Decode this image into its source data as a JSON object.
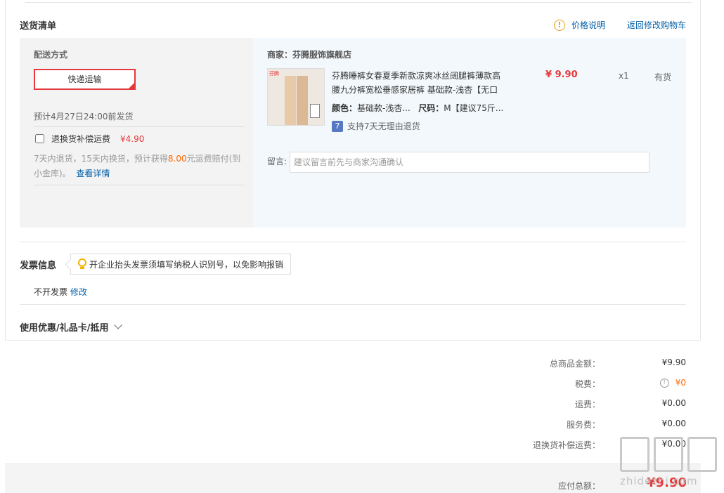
{
  "delivery": {
    "title": "送货清单",
    "price_note": "价格说明",
    "back_to_cart": "返回修改购物车",
    "shipping_method_label": "配送方式",
    "express_option": "快递运输",
    "ship_date": "预计4月27日24:00前发货",
    "return_insurance_label": "退换货补偿运费",
    "return_insurance_price": "¥4.90",
    "return_desc_prefix": "7天内退货，15天内换货，预计获得",
    "return_desc_amount": "8.00",
    "return_desc_suffix": "元运费赔付(到小金库)。",
    "view_details": "查看详情"
  },
  "goods": {
    "merchant": "商家：芬腾服饰旗舰店",
    "thumb_brand": "芬腾",
    "name": "芬腾睡裤女春夏季新款凉爽冰丝阔腿裤薄款高腰九分裤宽松垂感家居裤 基础款-浅杏【无口",
    "color_label": "颜色：",
    "color_value": "基础款-浅杏...",
    "size_label": "尺码：",
    "size_value": "M【建议75斤...",
    "support_badge": "7",
    "support_text": "支持7天无理由退货",
    "price": "¥ 9.90",
    "qty": "x1",
    "stock": "有货",
    "message_label": "留言:",
    "message_placeholder": "建议留言前先与商家沟通确认"
  },
  "invoice": {
    "title": "发票信息",
    "tip": "开企业抬头发票须填写纳税人识别号，以免影响报销",
    "status": "不开发票",
    "edit": "修改"
  },
  "coupon": {
    "title": "使用优惠/礼品卡/抵用"
  },
  "summary": {
    "goods_total_label": "总商品金额：",
    "goods_total": "¥9.90",
    "tax_label": "税费：",
    "tax": "¥0",
    "shipping_label": "运费：",
    "shipping": "¥0.00",
    "service_label": "服务费：",
    "service": "¥0.00",
    "return_fee_label": "退换货补偿运费：",
    "return_fee": "¥0.00",
    "payable_label": "应付总额：",
    "payable": "¥9.90"
  },
  "watermark": {
    "text": "zhidezhi.com"
  },
  "colors": {
    "accent_red": "#e4393c",
    "link_blue": "#005ea7",
    "warning_orange": "#f60"
  }
}
